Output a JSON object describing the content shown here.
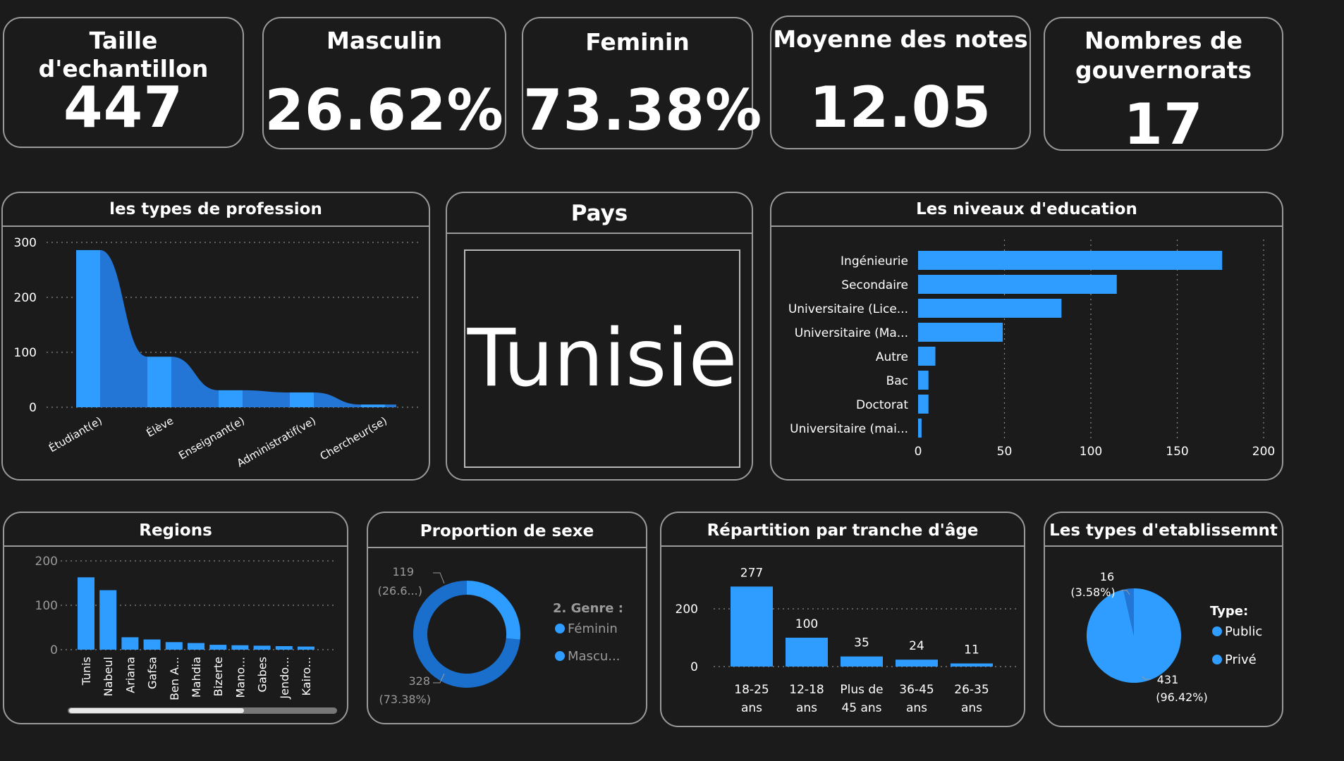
{
  "colors": {
    "background": "#1b1b1b",
    "accent": "#2f9cff",
    "accent_dark": "#1a6fcc",
    "accent_mid": "#2376d6",
    "grid": "#8a8a8a",
    "muted_text": "#9a9a9a"
  },
  "kpis": [
    {
      "title": "Taille d'echantillon",
      "value": "447"
    },
    {
      "title": "Masculin",
      "value": "26.62%"
    },
    {
      "title": "Feminin",
      "value": "73.38%"
    },
    {
      "title": "Moyenne des notes",
      "value": "12.05"
    },
    {
      "title_line1": "Nombres de",
      "title_line2": "gouvernorats",
      "value": "17"
    }
  ],
  "pays": {
    "title": "Pays",
    "value": "Tunisie"
  },
  "chart_data": [
    {
      "id": "profession",
      "type": "area",
      "title": "les types de profession",
      "categories": [
        "Étudiant(e)",
        "Élève",
        "Enseignant(e)",
        "Administratif(ve)",
        "Chercheur(se)"
      ],
      "values": [
        286,
        92,
        31,
        27,
        5
      ],
      "ylim": [
        0,
        300
      ],
      "yticks": [
        0,
        100,
        200,
        300
      ],
      "grid": true
    },
    {
      "id": "education",
      "type": "bar",
      "orientation": "horizontal",
      "title": "Les niveaux d'education",
      "categories": [
        "Ingénieurie",
        "Secondaire",
        "Universitaire (Lice...",
        "Universitaire (Ma...",
        "Autre",
        "Bac",
        "Doctorat",
        "Universitaire (mai..."
      ],
      "values": [
        176,
        115,
        83,
        49,
        10,
        6,
        6,
        2
      ],
      "xlim": [
        0,
        200
      ],
      "xticks": [
        0,
        50,
        100,
        150,
        200
      ],
      "grid": true
    },
    {
      "id": "regions",
      "type": "bar",
      "title": "Regions",
      "categories": [
        "Tunis",
        "Nabeul",
        "Ariana",
        "Gafsa",
        "Ben A...",
        "Mahdia",
        "Bizerte",
        "Mano...",
        "Gabes",
        "Jendo...",
        "Kairo..."
      ],
      "values": [
        163,
        134,
        28,
        23,
        17,
        15,
        11,
        10,
        9,
        8,
        7
      ],
      "ylim": [
        0,
        200
      ],
      "yticks": [
        0,
        100,
        200
      ],
      "grid": true
    },
    {
      "id": "sexe",
      "type": "pie",
      "style": "donut",
      "title": "Proportion de sexe",
      "legend_title": "2. Genre :",
      "legend_placement": "right",
      "slices": [
        {
          "name": "Féminin",
          "value": 328,
          "label_line1": "328",
          "label_line2": "(73.38%)"
        },
        {
          "name": "Mascu...",
          "value": 119,
          "label_line1": "119",
          "label_line2": "(26.6...)"
        }
      ]
    },
    {
      "id": "age",
      "type": "bar",
      "title": "Répartition par tranche d'âge",
      "categories": [
        [
          "18-25",
          "ans"
        ],
        [
          "12-18",
          "ans"
        ],
        [
          "Plus de",
          "45 ans"
        ],
        [
          "36-45",
          "ans"
        ],
        [
          "26-35",
          "ans"
        ]
      ],
      "values": [
        277,
        100,
        35,
        24,
        11
      ],
      "ylim": [
        0,
        290
      ],
      "yticks": [
        0,
        200
      ],
      "grid": true,
      "data_labels": true
    },
    {
      "id": "etablissement",
      "type": "pie",
      "title": "Les types d'etablissemnt",
      "legend_title": "Type:",
      "legend_placement": "right",
      "slices": [
        {
          "name": "Public",
          "value": 431,
          "label_line1": "431",
          "label_line2": "(96.42%)"
        },
        {
          "name": "Privé",
          "value": 16,
          "label_line1": "16",
          "label_line2": "(3.58%)"
        }
      ]
    }
  ]
}
